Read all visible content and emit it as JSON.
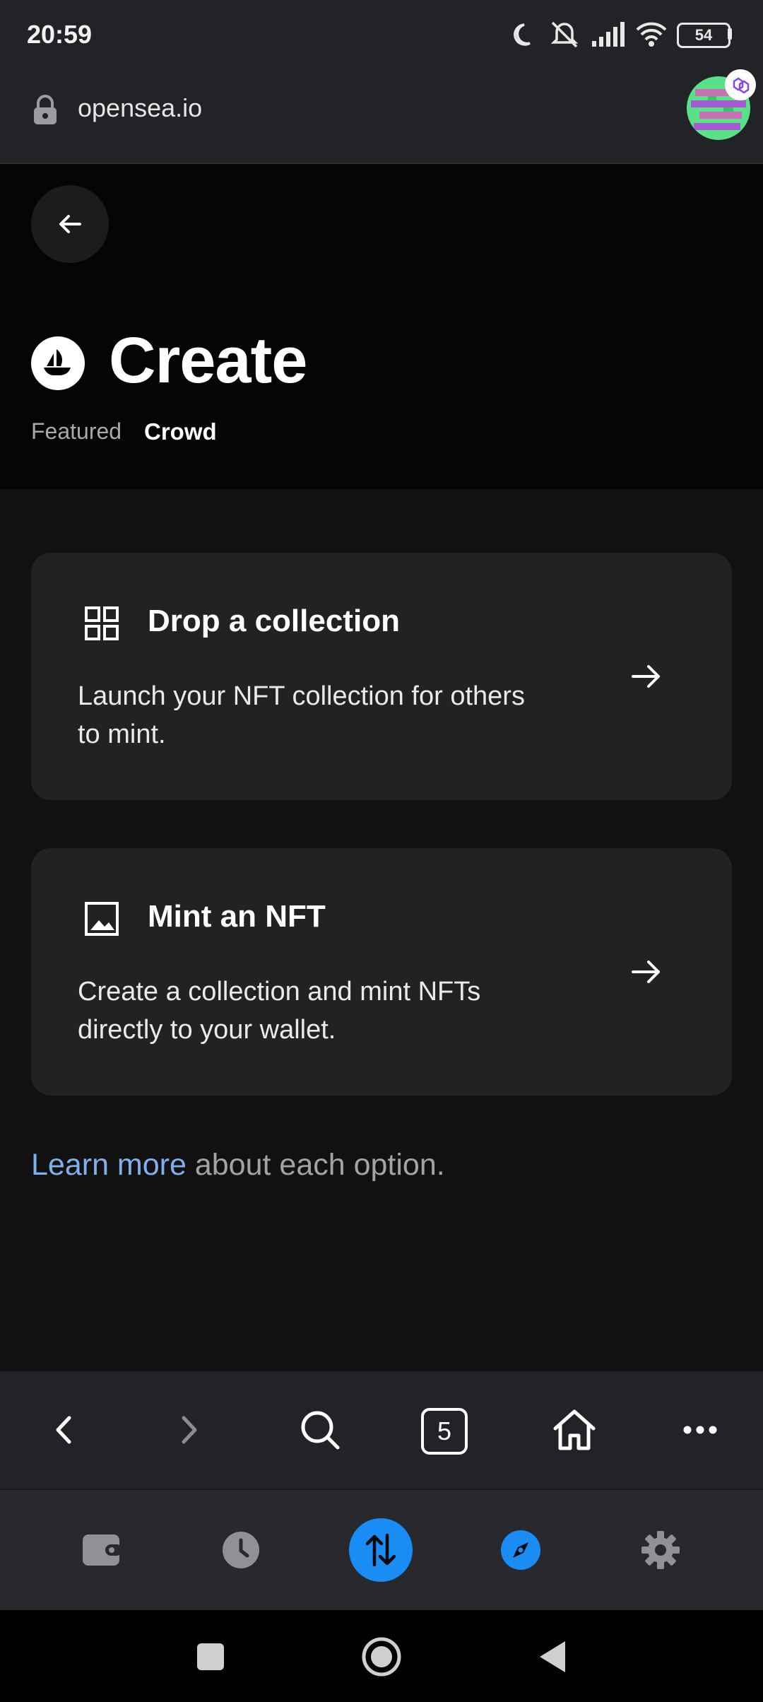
{
  "status_bar": {
    "time": "20:59",
    "battery": "54"
  },
  "browser": {
    "url": "opensea.io",
    "tab_count": "5"
  },
  "header": {
    "title": "Create",
    "tabs": [
      {
        "label": "Featured"
      },
      {
        "label": "Crowd"
      }
    ]
  },
  "cards": [
    {
      "title": "Drop a collection",
      "description": "Launch your NFT collection for others to mint.",
      "icon": "grid-icon"
    },
    {
      "title": "Mint an NFT",
      "description": "Create a collection and mint NFTs directly to your wallet.",
      "icon": "image-icon"
    }
  ],
  "footer_note": {
    "link": "Learn more",
    "text": " about each option."
  },
  "colors": {
    "accent_blue": "#1a8df5",
    "link": "#7fb0ec",
    "background": "#111112",
    "card": "#222224"
  }
}
